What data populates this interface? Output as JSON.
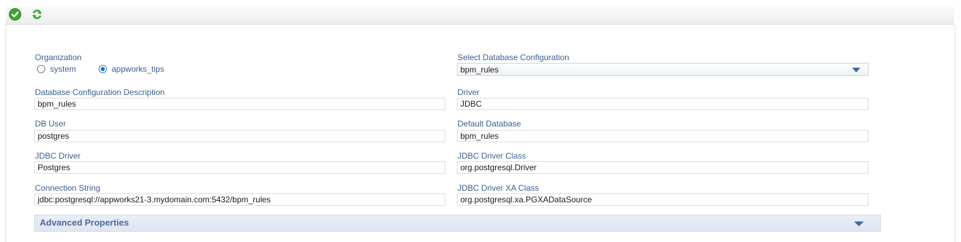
{
  "toolbar": {
    "save_icon": "green-check-icon",
    "refresh_icon": "green-refresh-icon"
  },
  "form": {
    "organization": {
      "label": "Organization",
      "options": [
        "system",
        "appworks_tips"
      ],
      "selected": "appworks_tips"
    },
    "select_db_config": {
      "label": "Select Database Configuration",
      "value": "bpm_rules"
    },
    "db_config_description": {
      "label": "Database Configuration Description",
      "value": "bpm_rules"
    },
    "driver": {
      "label": "Driver",
      "value": "JDBC"
    },
    "db_user": {
      "label": "DB User",
      "value": "postgres"
    },
    "default_database": {
      "label": "Default Database",
      "value": "bpm_rules"
    },
    "jdbc_driver": {
      "label": "JDBC Driver",
      "value": "Postgres"
    },
    "jdbc_driver_class": {
      "label": "JDBC Driver Class",
      "value": "org.postgresql.Driver"
    },
    "connection_string": {
      "label": "Connection String",
      "value": "jdbc:postgresql://appworks21-3.mydomain.com:5432/bpm_rules"
    },
    "jdbc_driver_xa_class": {
      "label": "JDBC Driver XA Class",
      "value": "org.postgresql.xa.PGXADataSource"
    }
  },
  "advanced": {
    "title": "Advanced Properties"
  },
  "colors": {
    "label": "#3b5f8f",
    "accent": "#3e66a8",
    "icon_green": "#3fa535"
  }
}
